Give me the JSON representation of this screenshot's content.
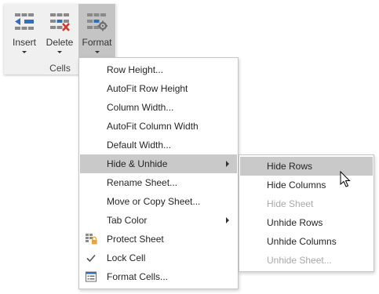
{
  "ribbon": {
    "buttons": [
      {
        "label": "Insert",
        "icon": "insert-rows-icon"
      },
      {
        "label": "Delete",
        "icon": "delete-rows-icon"
      },
      {
        "label": "Format",
        "icon": "format-cells-icon"
      }
    ],
    "group_label": "Cells",
    "active_button": "Format"
  },
  "format_menu": {
    "items": [
      {
        "label": "Row Height..."
      },
      {
        "label": "AutoFit Row Height"
      },
      {
        "label": "Column Width..."
      },
      {
        "label": "AutoFit Column Width"
      },
      {
        "label": "Default Width..."
      },
      {
        "label": "Hide & Unhide",
        "submenu": true,
        "highlighted": true
      },
      {
        "label": "Rename Sheet..."
      },
      {
        "label": "Move or Copy Sheet..."
      },
      {
        "label": "Tab Color",
        "submenu": true
      },
      {
        "label": "Protect Sheet",
        "icon": "protect-sheet-icon"
      },
      {
        "label": "Lock Cell",
        "icon": "checkmark-icon",
        "checked": true
      },
      {
        "label": "Format Cells...",
        "icon": "format-cells-dialog-icon"
      }
    ]
  },
  "hide_unhide_submenu": {
    "items": [
      {
        "label": "Hide Rows",
        "highlighted": true,
        "enabled": true
      },
      {
        "label": "Hide Columns",
        "enabled": true
      },
      {
        "label": "Hide Sheet",
        "enabled": false
      },
      {
        "label": "Unhide Rows",
        "enabled": true
      },
      {
        "label": "Unhide Columns",
        "enabled": true
      },
      {
        "label": "Unhide Sheet...",
        "enabled": false
      }
    ]
  },
  "colors": {
    "ribbon_bg": "#f0f0f0",
    "active_button_bg": "#c4c4c4",
    "highlight_bg": "#c9c9c9",
    "disabled_text": "#a9a9a9",
    "icon_blue": "#2f6fbe",
    "icon_red": "#d9372b",
    "icon_gray": "#8a8a8a",
    "lock_gold": "#e8a531"
  }
}
